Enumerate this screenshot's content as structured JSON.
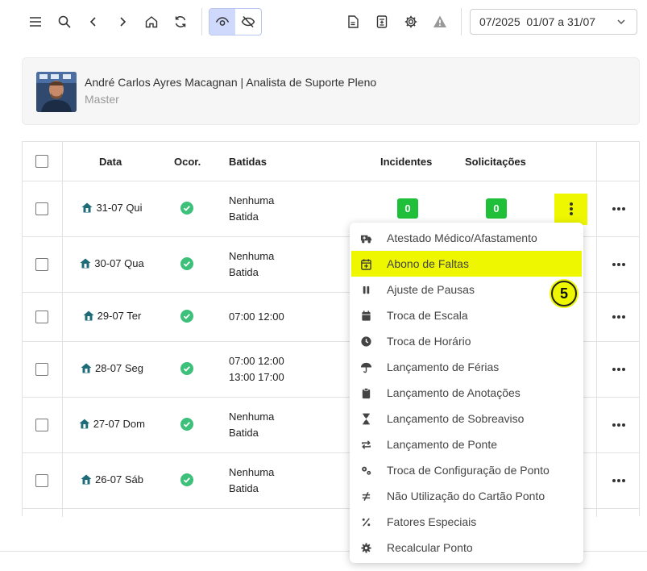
{
  "toolbar": {
    "icons": [
      "menu-icon",
      "search-icon",
      "chevron-left-icon",
      "chevron-right-icon",
      "home-icon",
      "refresh-icon",
      "eye-icon",
      "eye-off-icon",
      "document-icon",
      "calculator-icon",
      "gear-icon",
      "warning-icon"
    ],
    "period": "07/2025  01/07 a 31/07"
  },
  "user": {
    "name": "André Carlos Ayres Macagnan | Analista de Suporte Pleno",
    "role": "Master"
  },
  "table": {
    "headers": {
      "data": "Data",
      "ocor": "Ocor.",
      "batidas": "Batidas",
      "incidentes": "Incidentes",
      "solicitacoes": "Solicitações"
    },
    "rows": [
      {
        "date": "31-07 Qui",
        "batida1": "Nenhuma",
        "batida2": "Batida",
        "incidentes": "0",
        "solicitacoes": "0"
      },
      {
        "date": "30-07 Qua",
        "batida1": "Nenhuma",
        "batida2": "Batida"
      },
      {
        "date": "29-07 Ter",
        "batida1": "07:00 12:00",
        "batida2": ""
      },
      {
        "date": "28-07 Seg",
        "batida1": "07:00 12:00",
        "batida2": "13:00 17:00"
      },
      {
        "date": "27-07 Dom",
        "batida1": "Nenhuma",
        "batida2": "Batida"
      },
      {
        "date": "26-07 Sáb",
        "batida1": "Nenhuma",
        "batida2": "Batida"
      }
    ]
  },
  "menu": {
    "items": [
      {
        "label": "Atestado Médico/Afastamento",
        "icon": "ambulance-icon"
      },
      {
        "label": "Abono de Faltas",
        "icon": "calendar-plus-icon"
      },
      {
        "label": "Ajuste de Pausas",
        "icon": "pause-icon"
      },
      {
        "label": "Troca de Escala",
        "icon": "calendar-icon"
      },
      {
        "label": "Troca de Horário",
        "icon": "clock-icon"
      },
      {
        "label": "Lançamento de Férias",
        "icon": "umbrella-icon"
      },
      {
        "label": "Lançamento de Anotações",
        "icon": "clipboard-icon"
      },
      {
        "label": "Lançamento de Sobreaviso",
        "icon": "hourglass-icon"
      },
      {
        "label": "Lançamento de Ponte",
        "icon": "repeat-icon"
      },
      {
        "label": "Troca de Configuração de Ponto",
        "icon": "cogs-icon"
      },
      {
        "label": "Não Utilização do Cartão Ponto",
        "icon": "not-equal-icon"
      },
      {
        "label": "Fatores Especiais",
        "icon": "percent-icon"
      },
      {
        "label": "Recalcular Ponto",
        "icon": "gear-icon"
      }
    ],
    "highlighted_index": 1,
    "step_number": "5"
  },
  "colors": {
    "highlight": "#eef700",
    "badge_green": "#1fbf3a",
    "ok_green": "#3cc07a",
    "home_teal": "#1e6b78"
  }
}
